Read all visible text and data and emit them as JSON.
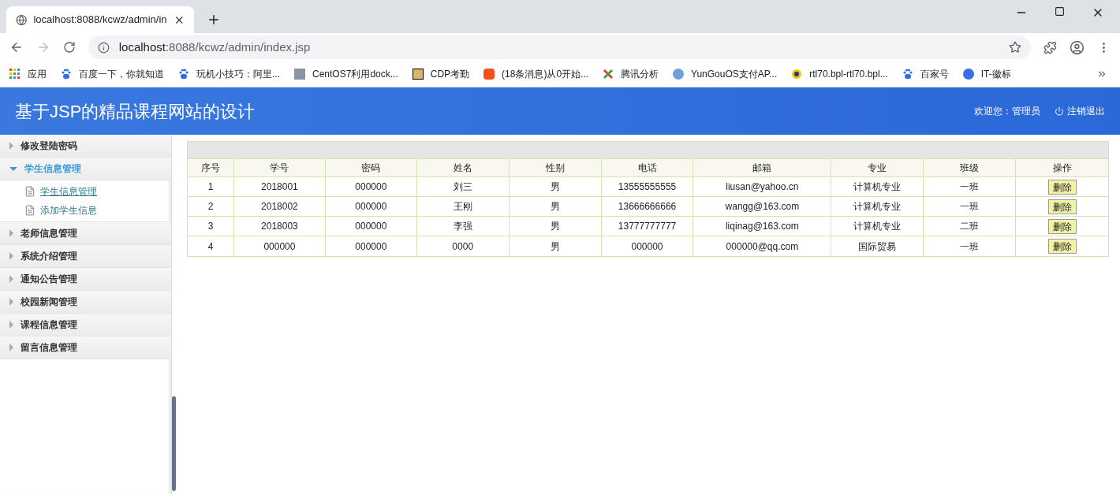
{
  "browser": {
    "tab_title": "localhost:8088/kcwz/admin/in",
    "url_host": "localhost",
    "url_path": ":8088/kcwz/admin/index.jsp",
    "bookmarks": [
      {
        "label": "应用",
        "kind": "apps"
      },
      {
        "label": "百度一下，你就知道",
        "kind": "paw"
      },
      {
        "label": "玩机小技巧：阿里...",
        "kind": "paw"
      },
      {
        "label": "CentOS7利用dock...",
        "kind": "photo"
      },
      {
        "label": "CDP考勤",
        "kind": "frame"
      },
      {
        "label": "(18条消息)从0开始...",
        "kind": "csdn"
      },
      {
        "label": "腾讯分析",
        "kind": "cross"
      },
      {
        "label": "YunGouOS支付AP...",
        "kind": "cloud"
      },
      {
        "label": "rtl70.bpl-rtl70.bpl...",
        "kind": "disc"
      },
      {
        "label": "百家号",
        "kind": "paw"
      },
      {
        "label": "IT-徽标",
        "kind": "circle"
      }
    ]
  },
  "header": {
    "title": "基于JSP的精品课程网站的设计",
    "welcome": "欢迎您：管理员",
    "logout": "注销退出"
  },
  "sidebar": {
    "items": [
      {
        "label": "修改登陆密码",
        "expanded": false
      },
      {
        "label": "学生信息管理",
        "expanded": true,
        "children": [
          {
            "label": "学生信息管理",
            "selected": true
          },
          {
            "label": "添加学生信息",
            "selected": false
          }
        ]
      },
      {
        "label": "老师信息管理",
        "expanded": false
      },
      {
        "label": "系统介绍管理",
        "expanded": false
      },
      {
        "label": "通知公告管理",
        "expanded": false
      },
      {
        "label": "校园新闻管理",
        "expanded": false
      },
      {
        "label": "课程信息管理",
        "expanded": false
      },
      {
        "label": "留言信息管理",
        "expanded": false
      }
    ]
  },
  "table": {
    "columns": [
      "序号",
      "学号",
      "密码",
      "姓名",
      "性别",
      "电话",
      "邮箱",
      "专业",
      "班级",
      "操作"
    ],
    "rows": [
      {
        "cells": [
          "1",
          "2018001",
          "000000",
          "刘三",
          "男",
          "13555555555",
          "liusan@yahoo.cn",
          "计算机专业",
          "一班"
        ],
        "action": "删除"
      },
      {
        "cells": [
          "2",
          "2018002",
          "000000",
          "王刚",
          "男",
          "13666666666",
          "wangg@163.com",
          "计算机专业",
          "一班"
        ],
        "action": "删除"
      },
      {
        "cells": [
          "3",
          "2018003",
          "000000",
          "李强",
          "男",
          "13777777777",
          "liqinag@163.com",
          "计算机专业",
          "二班"
        ],
        "action": "删除"
      },
      {
        "cells": [
          "4",
          "000000",
          "000000",
          "0000",
          "男",
          "000000",
          "000000@qq.com",
          "国际贸易",
          "一班"
        ],
        "action": "删除"
      }
    ]
  }
}
